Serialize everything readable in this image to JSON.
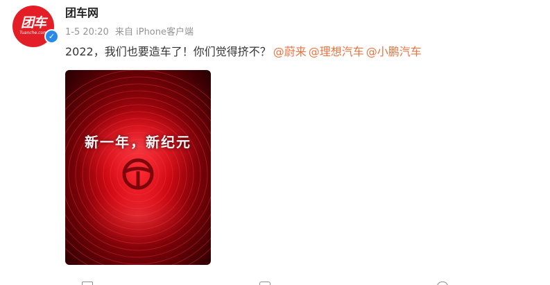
{
  "author": {
    "name": "团车网",
    "avatar_logo_text": "团车",
    "avatar_sub_text": "Tuanche.com",
    "verified_icon": "verified-check-icon"
  },
  "meta": {
    "timestamp": "1-5 20:20",
    "source": "来自 iPhone客户端"
  },
  "post": {
    "text": "2022，我们也要造车了！你们觉得挤不？",
    "mentions": [
      "@蔚来",
      "@理想汽车",
      "@小鹏汽车"
    ]
  },
  "image": {
    "caption": "新一年，新纪元",
    "colors": {
      "dark": "#3a0003",
      "mid": "#b5060e",
      "bright": "#ff1f2a"
    }
  },
  "actions": {
    "repost_icon": "repost-icon",
    "comment_icon": "comment-icon",
    "like_icon": "like-icon"
  },
  "colors": {
    "mention": "#eb7340",
    "meta": "#939393",
    "text": "#333333",
    "brand": "#e41e26",
    "verified": "#2a8ae8"
  }
}
